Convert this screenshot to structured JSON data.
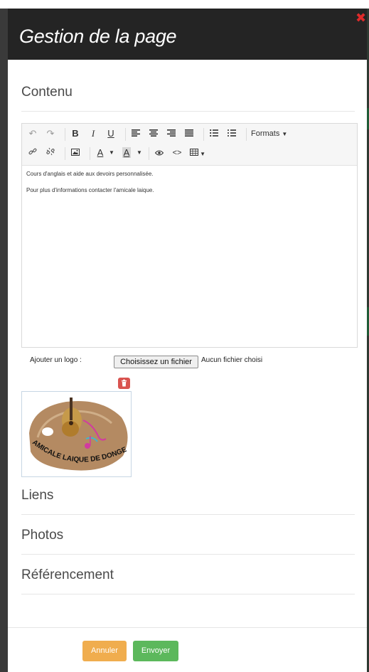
{
  "modal": {
    "title": "Gestion de la page",
    "close_glyph": "✖"
  },
  "sections": {
    "contenu": "Contenu",
    "liens": "Liens",
    "photos": "Photos",
    "referencement": "Référencement"
  },
  "toolbar": {
    "undo": "↶",
    "redo": "↷",
    "bold": "B",
    "italic": "I",
    "underline": "U",
    "formats_label": "Formats",
    "text_color_label": "A",
    "bg_color_label": "A",
    "code_label": "<>"
  },
  "editor": {
    "paragraphs": [
      "Cours d'anglais et aide aux devoirs personnalisée.",
      "Pour plus d'informations contacter l'amicale laique."
    ]
  },
  "logo_upload": {
    "label": "Ajouter un logo :",
    "button_label": "Choisissez un fichier",
    "status": "Aucun fichier choisi"
  },
  "logo_image": {
    "text": "AMICALE LAIQUE DE DONGES"
  },
  "footer": {
    "cancel_label": "Annuler",
    "submit_label": "Envoyer"
  },
  "colors": {
    "header_bg": "#242424",
    "cancel": "#f0ad4e",
    "submit": "#5cb85c",
    "delete": "#d9534f",
    "close": "#e02b2b"
  }
}
